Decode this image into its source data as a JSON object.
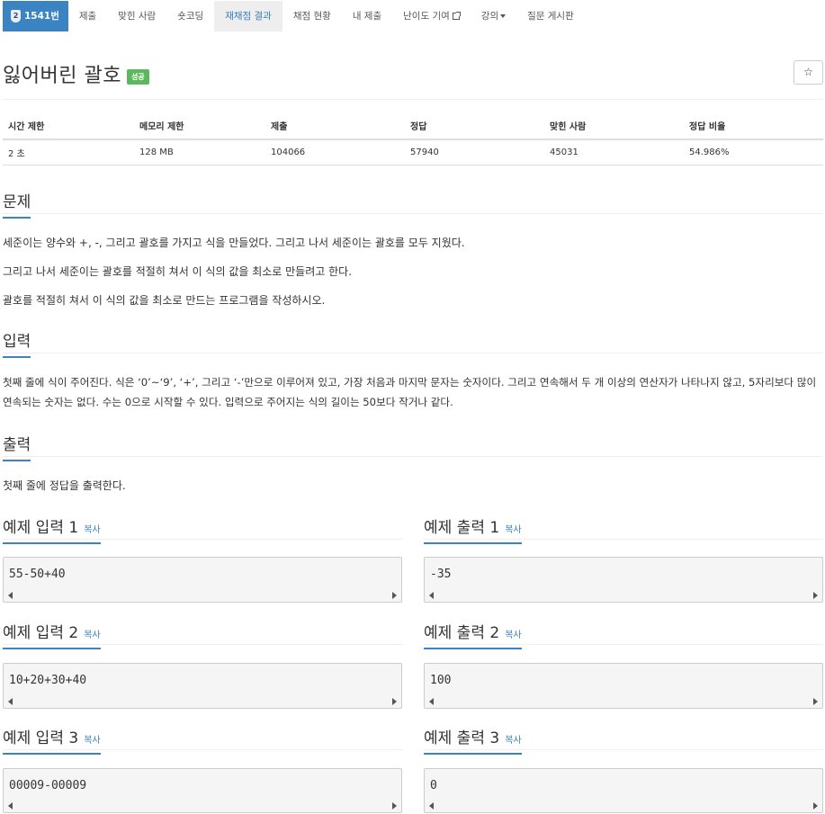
{
  "tabs": {
    "problem": {
      "tier": "2",
      "label": "1541번"
    },
    "submit": "제출",
    "solved_users": "맞힌 사람",
    "shortest": "숏코딩",
    "rejudge": "재채점 결과",
    "judge_status": "채점 현황",
    "my_submissions": "내 제출",
    "difficulty": "난이도 기여",
    "lectures": "강의",
    "qna": "질문 게시판"
  },
  "problem": {
    "title": "잃어버린 괄호",
    "status": "성공",
    "star": "☆"
  },
  "info_table": {
    "headers": [
      "시간 제한",
      "메모리 제한",
      "제출",
      "정답",
      "맞힌 사람",
      "정답 비율"
    ],
    "values": [
      "2 초",
      "128 MB",
      "104066",
      "57940",
      "45031",
      "54.986%"
    ]
  },
  "sections": {
    "description": {
      "title": "문제",
      "paragraphs": [
        "세준이는 양수와 +, -, 그리고 괄호를 가지고 식을 만들었다. 그리고 나서 세준이는 괄호를 모두 지웠다.",
        "그리고 나서 세준이는 괄호를 적절히 쳐서 이 식의 값을 최소로 만들려고 한다.",
        "괄호를 적절히 쳐서 이 식의 값을 최소로 만드는 프로그램을 작성하시오."
      ]
    },
    "input": {
      "title": "입력",
      "text": "첫째 줄에 식이 주어진다. 식은 ‘0’~‘9’, ‘+’, 그리고 ‘-’만으로 이루어져 있고, 가장 처음과 마지막 문자는 숫자이다. 그리고 연속해서 두 개 이상의 연산자가 나타나지 않고, 5자리보다 많이 연속되는 숫자는 없다. 수는 0으로 시작할 수 있다. 입력으로 주어지는 식의 길이는 50보다 작거나 같다."
    },
    "output": {
      "title": "출력",
      "text": "첫째 줄에 정답을 출력한다."
    }
  },
  "copy_label": "복사",
  "samples": [
    {
      "input_title": "예제 입력 1",
      "input": "55-50+40",
      "output_title": "예제 출력 1",
      "output": "-35"
    },
    {
      "input_title": "예제 입력 2",
      "input": "10+20+30+40",
      "output_title": "예제 출력 2",
      "output": "100"
    },
    {
      "input_title": "예제 입력 3",
      "input": "00009-00009",
      "output_title": "예제 출력 3",
      "output": "0"
    }
  ]
}
